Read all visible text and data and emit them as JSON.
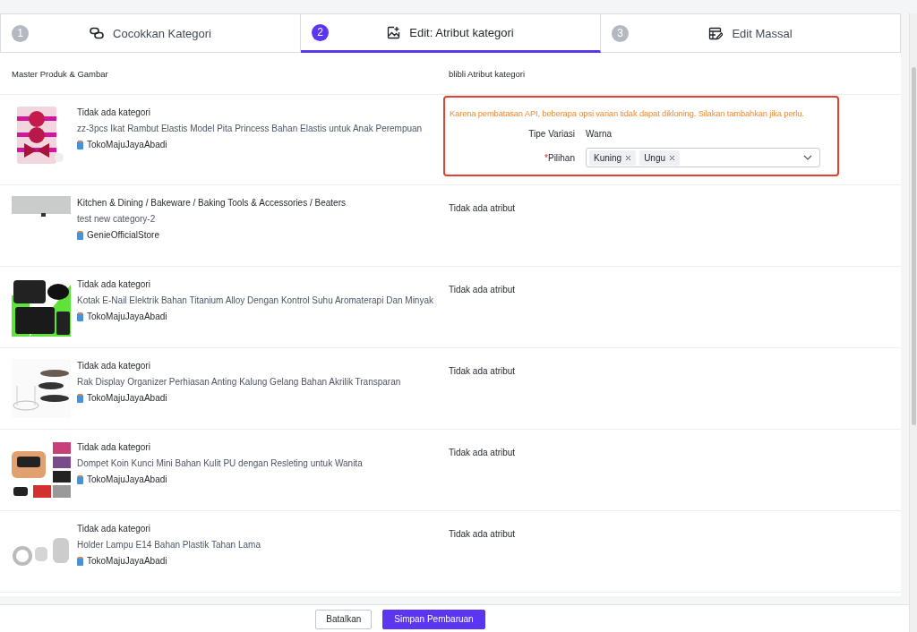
{
  "steps": [
    {
      "number": "1",
      "label": "Cocokkan Kategori",
      "selected": false
    },
    {
      "number": "2",
      "label": "Edit: Atribut kategori",
      "selected": true
    },
    {
      "number": "3",
      "label": "Edit Massal",
      "selected": false
    }
  ],
  "table": {
    "columns": [
      "Master Produk & Gambar",
      "blibli Atribut kategori"
    ],
    "rows": [
      {
        "category": "Tidak ada kategori",
        "name": "zz-3pcs Ikat Rambut Elastis Model Pita Princess Bahan Elastis untuk Anak Perempuan",
        "store": "TokoMajuJayaAbadi",
        "attribute": {
          "kind": "variant_form",
          "warning": "Karena pembatasan API, beberapa opsi varian tidak dapat dikloning. Silakan tambahkan jika perlu.",
          "type_label": "Tipe Variasi",
          "type_value": "Warna",
          "required_mark": "*",
          "options_label": "Pilihan",
          "options": [
            "Kuning",
            "Ungu"
          ]
        }
      },
      {
        "category": "Kitchen & Dining / Bakeware / Baking Tools & Accessories / Beaters",
        "name": "test new category-2",
        "store": "GenieOfficialStore",
        "attribute": {
          "kind": "empty",
          "text": "Tidak ada atribut"
        }
      },
      {
        "category": "Tidak ada kategori",
        "name": "Kotak E-Nail Elektrik Bahan Titanium Alloy Dengan Kontrol Suhu Aromaterapi Dan Minyak",
        "store": "TokoMajuJayaAbadi",
        "attribute": {
          "kind": "empty",
          "text": "Tidak ada atribut"
        }
      },
      {
        "category": "Tidak ada kategori",
        "name": "Rak Display Organizer Perhiasan Anting Kalung Gelang Bahan Akrilik Transparan",
        "store": "TokoMajuJayaAbadi",
        "attribute": {
          "kind": "empty",
          "text": "Tidak ada atribut"
        }
      },
      {
        "category": "Tidak ada kategori",
        "name": "Dompet Koin Kunci Mini Bahan Kulit PU dengan Resleting untuk Wanita",
        "store": "TokoMajuJayaAbadi",
        "attribute": {
          "kind": "empty",
          "text": "Tidak ada atribut"
        }
      },
      {
        "category": "Tidak ada kategori",
        "name": "Holder Lampu E14 Bahan Plastik Tahan Lama",
        "store": "TokoMajuJayaAbadi",
        "attribute": {
          "kind": "empty",
          "text": "Tidak ada atribut"
        }
      }
    ]
  },
  "footer": {
    "cancel": "Batalkan",
    "save": "Simpan Pembaruan"
  }
}
